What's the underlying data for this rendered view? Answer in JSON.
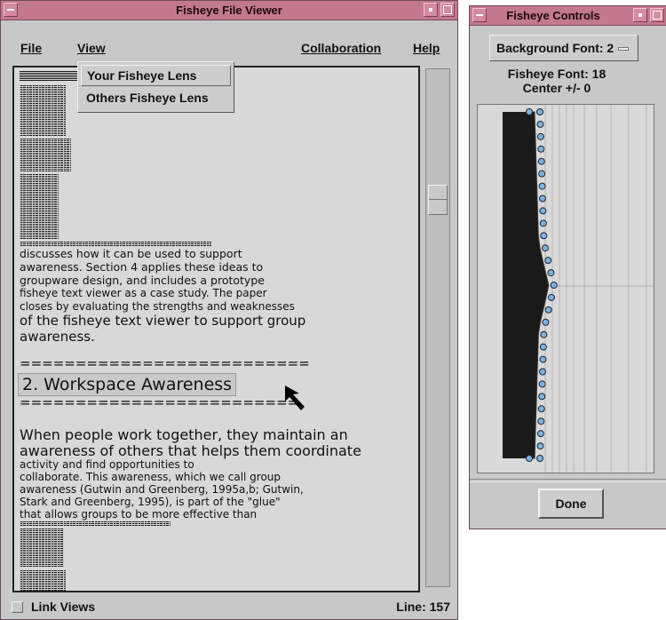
{
  "viewer": {
    "title": "Fisheye File Viewer",
    "menu": {
      "file": "File",
      "view": "View",
      "collaboration": "Collaboration",
      "help": "Help"
    },
    "view_menu_items": [
      "Your Fisheye Lens",
      "Others Fisheye Lens"
    ],
    "text_lines": [
      {
        "text": "discusses how it can be used to support",
        "size": 12.5
      },
      {
        "text": "awareness. Section 4 applies these ideas to",
        "size": 12.5
      },
      {
        "text": "groupware design, and includes a prototype",
        "size": 12.5
      },
      {
        "text": "fisheye text viewer as a case study. The paper",
        "size": 12
      },
      {
        "text": "closes by evaluating the strengths and weaknesses",
        "size": 12
      },
      {
        "text": "of the fisheye text viewer to support group",
        "size": 15
      },
      {
        "text": "awareness.",
        "size": 15
      },
      {
        "text": "==========================",
        "size": 15
      },
      {
        "text": "=========================",
        "size": 15
      },
      {
        "text": "When people work together, they maintain an",
        "size": 16
      },
      {
        "text": "awareness of others that helps them coordinate",
        "size": 16
      },
      {
        "text": "activity and find opportunities to",
        "size": 12
      },
      {
        "text": "collaborate. This awareness, which we call group",
        "size": 12
      },
      {
        "text": "awareness (Gutwin and Greenberg, 1995a,b; Gutwin,",
        "size": 12
      },
      {
        "text": "Stark and Greenberg, 1995), is part of the \"glue\"",
        "size": 12
      },
      {
        "text": "that allows groups to be more effective than",
        "size": 12
      }
    ],
    "section_heading": "2. Workspace Awareness",
    "link_views_label": "Link Views",
    "line_indicator": "Line: 157"
  },
  "controls": {
    "title": "Fisheye Controls",
    "background_font": "Background Font: 2",
    "fisheye_font": "Fisheye Font: 18",
    "center": "Center +/- 0",
    "done_label": "Done"
  },
  "colors": {
    "titlebar": "#c4788e",
    "window_bg": "#c8c8c8",
    "text_bg": "#d8d8d8",
    "control_point": "#7ab4e0"
  }
}
